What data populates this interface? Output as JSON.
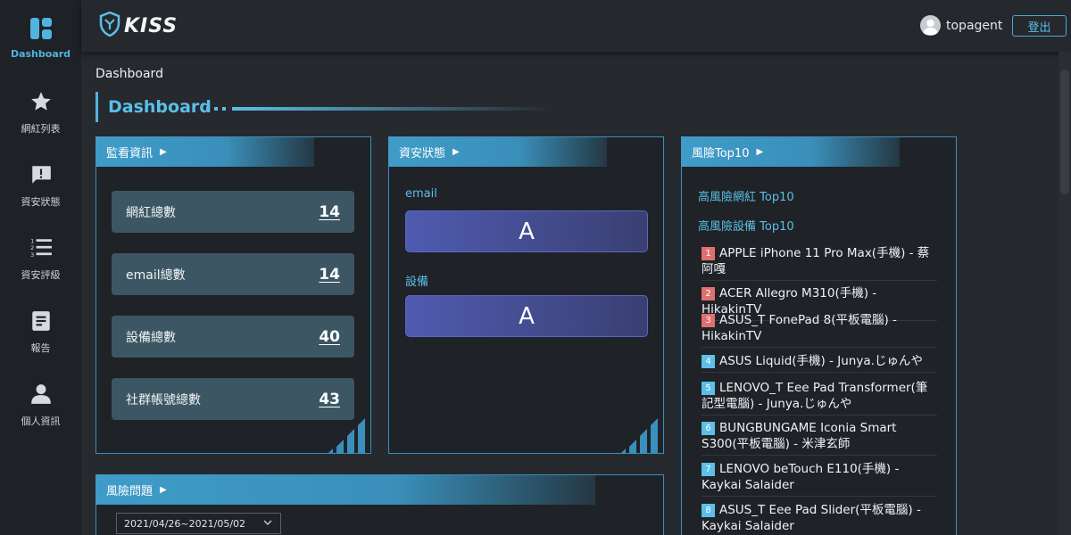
{
  "app": {
    "logo_text": "KISS"
  },
  "sidebar": {
    "items": [
      {
        "label": "Dashboard",
        "icon": "dashboard-icon"
      },
      {
        "label": "網紅列表",
        "icon": "star-icon"
      },
      {
        "label": "資安狀態",
        "icon": "alert-message-icon"
      },
      {
        "label": "資安評級",
        "icon": "ordered-list-icon"
      },
      {
        "label": "報告",
        "icon": "document-icon"
      },
      {
        "label": "個人資訊",
        "icon": "user-icon"
      }
    ]
  },
  "header": {
    "username": "topagent",
    "logout_label": "登出"
  },
  "breadcrumb": "Dashboard",
  "page_title": "Dashboard",
  "monitor_panel": {
    "title": "監看資訊",
    "stats": [
      {
        "label": "網紅總數",
        "value": "14"
      },
      {
        "label": "email總數",
        "value": "14"
      },
      {
        "label": "設備總數",
        "value": "40"
      },
      {
        "label": "社群帳號總數",
        "value": "43"
      }
    ]
  },
  "status_panel": {
    "title": "資安狀態",
    "email_label": "email",
    "email_grade": "A",
    "device_label": "設備",
    "device_grade": "A"
  },
  "risk_panel": {
    "title": "風險Top10",
    "link_influencer": "高風險網紅 Top10",
    "link_device": "高風險設備 Top10",
    "items": [
      {
        "rank": "1",
        "text": "APPLE iPhone 11 Pro Max(手機) - 蔡阿嘎"
      },
      {
        "rank": "2",
        "text": "ACER Allegro M310(手機) - HikakinTV"
      },
      {
        "rank": "3",
        "text": "ASUS_T FonePad 8(平板電腦) - HikakinTV"
      },
      {
        "rank": "4",
        "text": "ASUS Liquid(手機) - Junya.じゅんや"
      },
      {
        "rank": "5",
        "text": "LENOVO_T Eee Pad Transformer(筆記型電腦) - Junya.じゅんや"
      },
      {
        "rank": "6",
        "text": "BUNGBUNGAME Iconia Smart S300(平板電腦) - 米津玄師"
      },
      {
        "rank": "7",
        "text": "LENOVO beTouch E110(手機) - Kaykai Salaider"
      },
      {
        "rank": "8",
        "text": "ASUS_T Eee Pad Slider(平板電腦) - Kaykai Salaider"
      }
    ]
  },
  "issues_panel": {
    "title": "風險問題",
    "date_range": "2021/04/26~2021/05/02"
  },
  "colors": {
    "accent": "#4fb4e0",
    "rank_high": "#e07070",
    "rank_low": "#5bbfe8"
  }
}
